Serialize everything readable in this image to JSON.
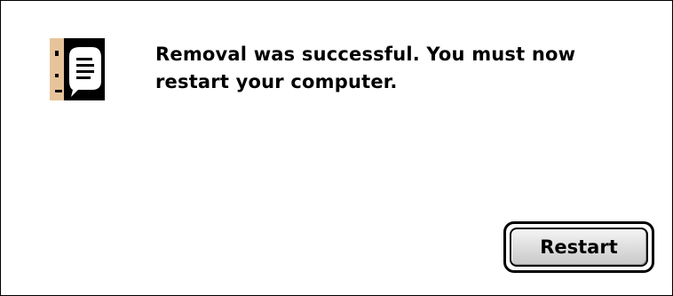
{
  "dialog": {
    "icon": "note-alert-icon",
    "message": "Removal was successful.  You must now restart your computer.",
    "restart_label": "Restart"
  },
  "colors": {
    "background": "#ffffff",
    "border": "#000000",
    "icon_face": "#e6c49a",
    "button_face": "#d9d9d9"
  }
}
